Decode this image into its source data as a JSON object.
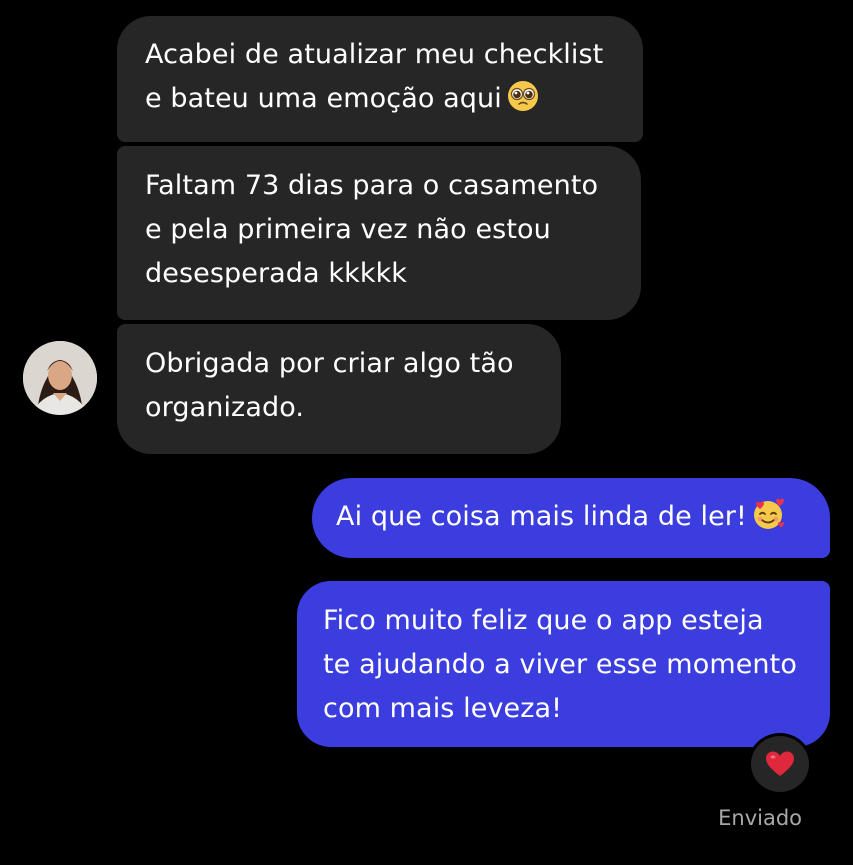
{
  "conversation": {
    "incoming": [
      {
        "text": "Acabei de atualizar meu checklist\ne bateu uma emoção aqui",
        "emoji": "pleading-face"
      },
      {
        "text": "Faltam 73 dias para o casamento\ne pela primeira vez não estou\ndesesperada kkkkk"
      },
      {
        "text": "Obrigada por criar algo tão\norganizado."
      }
    ],
    "outgoing": [
      {
        "text": "Ai que coisa mais linda de ler!",
        "emoji": "smiling-face-with-hearts"
      },
      {
        "text": "Fico muito feliz que o app esteja\nte ajudando a viver esse momento\ncom mais leveza!"
      }
    ]
  },
  "reaction": {
    "emoji": "red-heart"
  },
  "status": {
    "label": "Enviado"
  },
  "colors": {
    "background": "#000000",
    "incoming_bubble": "#262626",
    "outgoing_bubble": "#3c3ddf",
    "status_text": "#a8a8a8"
  }
}
